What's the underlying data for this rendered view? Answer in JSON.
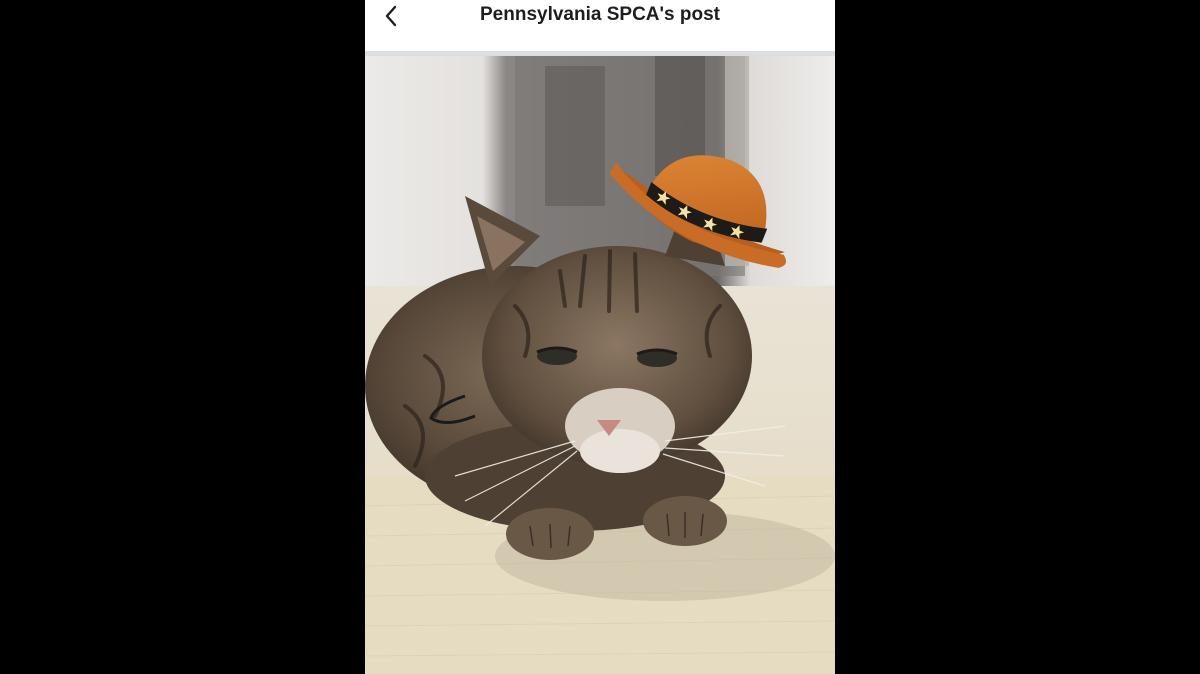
{
  "header": {
    "title": "Pennsylvania SPCA's post",
    "back_icon": "chevron-left-icon"
  },
  "post": {
    "photo_subject": "tabby cat wearing an orange cowboy hat",
    "hat_color": "#d97a2b"
  },
  "colors": {
    "page_background": "#000000",
    "topbar_background": "#ffffff",
    "divider": "#dadde1",
    "title_text": "#1c1e21"
  }
}
